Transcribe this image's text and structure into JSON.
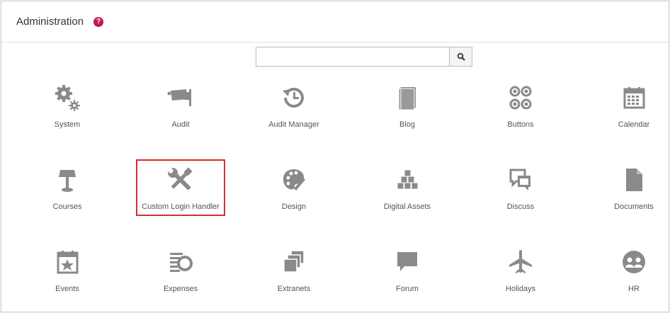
{
  "header": {
    "title": "Administration",
    "help_glyph": "?"
  },
  "search": {
    "value": "",
    "placeholder": "",
    "icon": "search-icon"
  },
  "accent_color": "#c2185b",
  "highlight_color": "#d32f2f",
  "icon_color": "#8a8a8a",
  "tiles": [
    {
      "label": "System",
      "icon": "gears-icon"
    },
    {
      "label": "Audit",
      "icon": "security-camera-icon"
    },
    {
      "label": "Audit Manager",
      "icon": "history-icon"
    },
    {
      "label": "Blog",
      "icon": "notebook-icon"
    },
    {
      "label": "Buttons",
      "icon": "buttons-icon"
    },
    {
      "label": "Calendar",
      "icon": "calendar-icon"
    },
    {
      "label": "Courses",
      "icon": "lectern-icon"
    },
    {
      "label": "Custom Login Handler",
      "icon": "wrench-screwdriver-icon"
    },
    {
      "label": "Design",
      "icon": "palette-icon"
    },
    {
      "label": "Digital Assets",
      "icon": "boxes-icon"
    },
    {
      "label": "Discuss",
      "icon": "chat-bubbles-icon"
    },
    {
      "label": "Documents",
      "icon": "document-icon"
    },
    {
      "label": "Events",
      "icon": "calendar-star-icon"
    },
    {
      "label": "Expenses",
      "icon": "coins-icon"
    },
    {
      "label": "Extranets",
      "icon": "stacked-windows-icon"
    },
    {
      "label": "Forum",
      "icon": "speech-bubble-icon"
    },
    {
      "label": "Holidays",
      "icon": "airplane-icon"
    },
    {
      "label": "HR",
      "icon": "people-circle-icon"
    }
  ]
}
